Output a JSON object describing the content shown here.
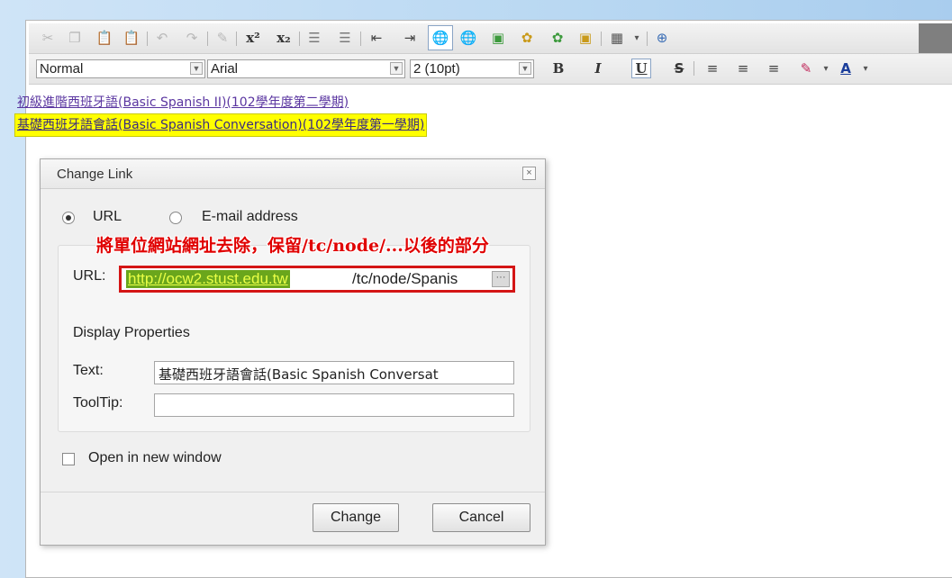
{
  "toolbar": {
    "icons": [
      "cut-icon",
      "copy-icon",
      "paste-icon",
      "paste-word-icon",
      "undo-icon",
      "redo-icon",
      "format-stripper-icon",
      "superscript-icon",
      "subscript-icon",
      "ordered-list-icon",
      "unordered-list-icon",
      "outdent-icon",
      "indent-icon",
      "hyperlink-icon",
      "unlink-icon",
      "image-icon",
      "flash-icon",
      "media-icon",
      "table-icon",
      "anchor-icon"
    ],
    "superscript_glyph": "x²",
    "subscript_glyph": "x₂"
  },
  "format_bar": {
    "paragraph_style": "Normal",
    "font_name": "Arial",
    "font_size": "2 (10pt)",
    "bold": "B",
    "italic": "I",
    "underline": "U",
    "strike": "S",
    "font_color_label": "A"
  },
  "document": {
    "link1": "初級進階西班牙語(Basic Spanish II)(102學年度第二學期)",
    "link2": "基礎西班牙語會話(Basic Spanish Conversation)(102學年度第一學期)"
  },
  "dialog": {
    "title": "Change Link",
    "close_glyph": "×",
    "radio_url": "URL",
    "radio_email": "E-mail address",
    "selected_type": "URL",
    "url_label": "URL:",
    "url_value_selected": "http://ocw2.stust.edu.tw",
    "url_value_rest": "/tc/node/Spanis",
    "browse_glyph": "···",
    "display_properties": "Display Properties",
    "text_label": "Text:",
    "text_value": "基礎西班牙語會話(Basic Spanish Conversat",
    "tooltip_label": "ToolTip:",
    "tooltip_value": "",
    "open_new_window": "Open in new window",
    "open_new_window_checked": false,
    "change_button": "Change",
    "cancel_button": "Cancel"
  },
  "annotation": "將單位網站網址去除，保留/tc/node/...以後的部分",
  "colors": {
    "annotation": "#e00000",
    "highlight": "#ffff00",
    "url_selection": "#6aa61c",
    "url_box_border": "#d41515"
  }
}
